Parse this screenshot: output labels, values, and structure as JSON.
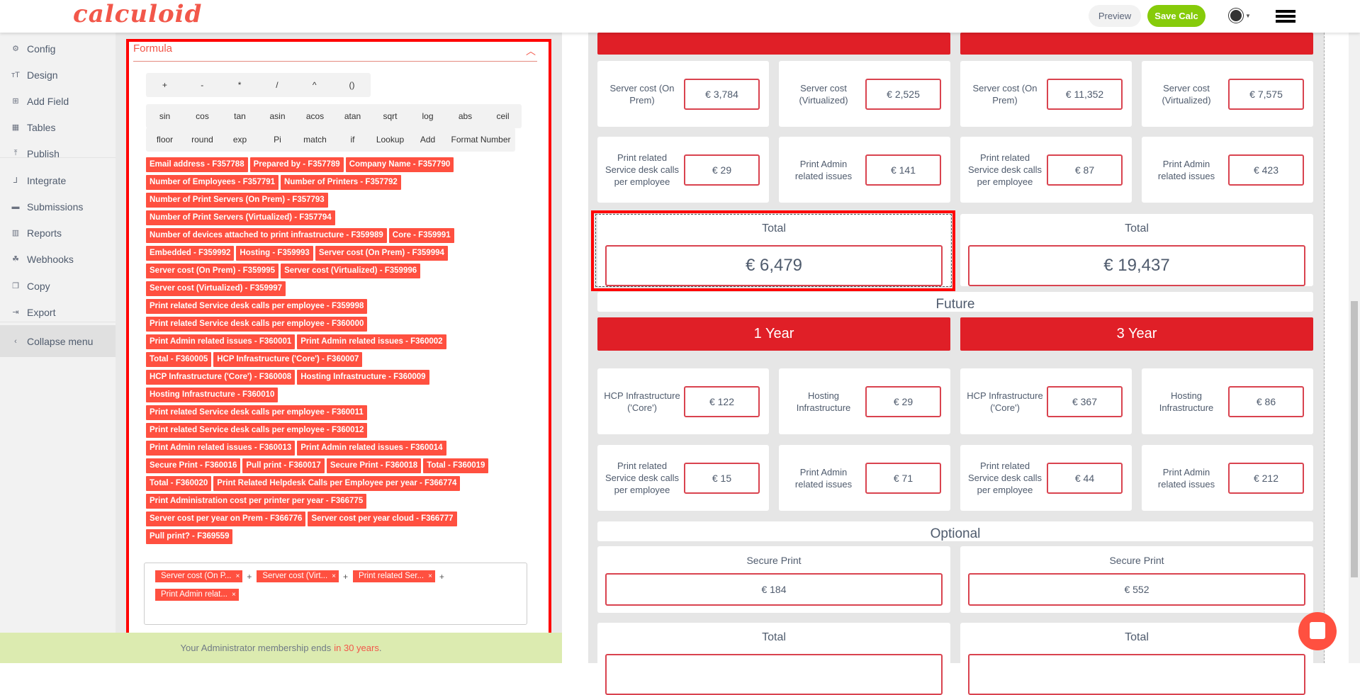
{
  "header": {
    "logo": "calculoid",
    "preview": "Preview",
    "save": "Save Calc"
  },
  "sidebar": {
    "items": [
      {
        "label": "Config",
        "icon": "gear-icon",
        "glyph": "⚙"
      },
      {
        "label": "Design",
        "icon": "text-height-icon",
        "glyph": "ᴛT"
      },
      {
        "label": "Add Field",
        "icon": "plus-square-icon",
        "glyph": "⊞"
      },
      {
        "label": "Tables",
        "icon": "table-icon",
        "glyph": "▦"
      },
      {
        "label": "Publish",
        "icon": "upload-icon",
        "glyph": "⤒"
      },
      {
        "label": "Integrate",
        "icon": "integrate-icon",
        "glyph": "⅃"
      },
      {
        "label": "Submissions",
        "icon": "archive-icon",
        "glyph": "▬"
      },
      {
        "label": "Reports",
        "icon": "bar-chart-icon",
        "glyph": "▥"
      },
      {
        "label": "Webhooks",
        "icon": "webhook-icon",
        "glyph": "☘"
      },
      {
        "label": "Copy",
        "icon": "copy-icon",
        "glyph": "❐"
      },
      {
        "label": "Export",
        "icon": "export-icon",
        "glyph": "⇥"
      },
      {
        "label": "Collapse menu",
        "icon": "chevron-left-icon",
        "glyph": "‹"
      }
    ]
  },
  "formula": {
    "title": "Formula",
    "operators": [
      "+",
      "-",
      "*",
      "/",
      "^",
      "()"
    ],
    "functions_row1": [
      "sin",
      "cos",
      "tan",
      "asin",
      "acos",
      "atan",
      "sqrt",
      "log",
      "abs",
      "ceil"
    ],
    "functions_row2": [
      "floor",
      "round",
      "exp",
      "Pi",
      "match",
      "if",
      "Lookup",
      "Add",
      "Format Number"
    ],
    "field_chips": [
      [
        "Email address - F357788",
        "Prepared by - F357789",
        "Company Name - F357790"
      ],
      [
        "Number of Employees - F357791",
        "Number of Printers - F357792"
      ],
      [
        "Number of Print Servers (On Prem) - F357793"
      ],
      [
        "Number of Print Servers (Virtualized) - F357794"
      ],
      [
        "Number of devices attached to print infrastructure - F359989",
        "Core - F359991"
      ],
      [
        "Embedded - F359992",
        "Hosting - F359993",
        "Server cost (On Prem) - F359994"
      ],
      [
        "Server cost (On Prem) - F359995",
        "Server cost (Virtualized) - F359996"
      ],
      [
        "Server cost (Virtualized) - F359997"
      ],
      [
        "Print related Service desk calls per employee - F359998"
      ],
      [
        "Print related Service desk calls per employee - F360000"
      ],
      [
        "Print Admin related issues - F360001",
        "Print Admin related issues - F360002"
      ],
      [
        "Total - F360005",
        "HCP Infrastructure ('Core') - F360007"
      ],
      [
        "HCP Infrastructure ('Core') - F360008",
        "Hosting Infrastructure - F360009"
      ],
      [
        "Hosting Infrastructure - F360010"
      ],
      [
        "Print related Service desk calls per employee - F360011"
      ],
      [
        "Print related Service desk calls per employee - F360012"
      ],
      [
        "Print Admin related issues - F360013",
        "Print Admin related issues - F360014"
      ],
      [
        "Secure Print - F360016",
        "Pull print - F360017",
        "Secure Print - F360018",
        "Total - F360019"
      ],
      [
        "Total - F360020",
        "Print Related Helpdesk Calls per Employee per year - F366774"
      ],
      [
        "Print Administration cost per printer per year - F366775"
      ],
      [
        "Server cost per year on Prem - F366776",
        "Server cost per year cloud - F366777"
      ],
      [
        "Pull print? - F369559"
      ]
    ],
    "tokens": [
      "Server cost (On P...",
      "Server cost (Virt...",
      "Print related Ser...",
      "Print Admin relat..."
    ],
    "operator_between": "+",
    "remove": "×"
  },
  "footer": {
    "text": "Your Administrator membership ends",
    "highlight": "in 30 years",
    "end": "."
  },
  "preview": {
    "current": {
      "row1": [
        {
          "label": "Server cost (On Prem)",
          "value": "€ 3,784"
        },
        {
          "label": "Server cost (Virtualized)",
          "value": "€ 2,525"
        },
        {
          "label": "Server cost (On Prem)",
          "value": "€ 11,352"
        },
        {
          "label": "Server cost (Virtualized)",
          "value": "€ 7,575"
        }
      ],
      "row2": [
        {
          "label": "Print related Service desk calls per employee",
          "value": "€ 29"
        },
        {
          "label": "Print Admin related issues",
          "value": "€ 141"
        },
        {
          "label": "Print related Service desk calls per employee",
          "value": "€ 87"
        },
        {
          "label": "Print Admin related issues",
          "value": "€ 423"
        }
      ],
      "totals": [
        {
          "label": "Total",
          "value": "€ 6,479"
        },
        {
          "label": "Total",
          "value": "€ 19,437"
        }
      ]
    },
    "future": {
      "title": "Future",
      "bars": [
        "1 Year",
        "3 Year"
      ],
      "row1": [
        {
          "label": "HCP Infrastructure ('Core')",
          "value": "€ 122"
        },
        {
          "label": "Hosting Infrastructure",
          "value": "€ 29"
        },
        {
          "label": "HCP Infrastructure ('Core')",
          "value": "€ 367"
        },
        {
          "label": "Hosting Infrastructure",
          "value": "€ 86"
        }
      ],
      "row2": [
        {
          "label": "Print related Service desk calls per employee",
          "value": "€ 15"
        },
        {
          "label": "Print Admin related issues",
          "value": "€ 71"
        },
        {
          "label": "Print related Service desk calls per employee",
          "value": "€ 44"
        },
        {
          "label": "Print Admin related issues",
          "value": "€ 212"
        }
      ]
    },
    "optional": {
      "title": "Optional",
      "secure": [
        {
          "label": "Secure Print",
          "value": "€ 184"
        },
        {
          "label": "Secure Print",
          "value": "€ 552"
        }
      ],
      "totals": [
        {
          "label": "Total"
        },
        {
          "label": "Total"
        }
      ]
    }
  },
  "colors": {
    "accent": "#ff5040",
    "bar": "#e01f27",
    "save": "#86cb0a",
    "footer": "#dcebb0"
  }
}
